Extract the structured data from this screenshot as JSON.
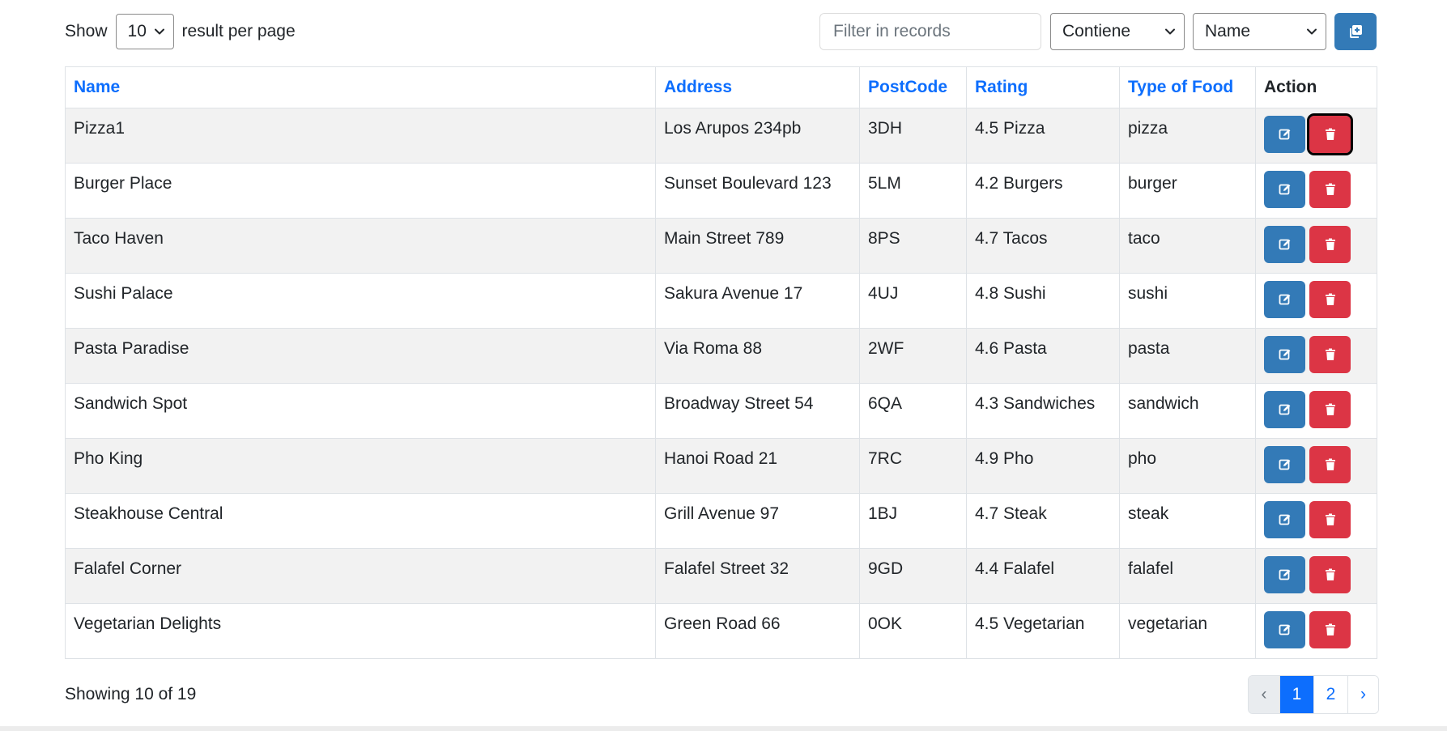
{
  "toolbar": {
    "show_label": "Show",
    "per_page_value": "10",
    "per_page_suffix": "result per page",
    "filter_placeholder": "Filter in records",
    "operator_value": "Contiene",
    "field_value": "Name",
    "add_icon": "add-copy-icon"
  },
  "table": {
    "headers": {
      "name": "Name",
      "address": "Address",
      "postcode": "PostCode",
      "rating": "Rating",
      "type": "Type of Food",
      "action": "Action"
    },
    "rows": [
      {
        "name": "Pizza1",
        "address": "Los Arupos 234pb",
        "postcode": "3DH",
        "rating": "4.5 Pizza",
        "type": "pizza"
      },
      {
        "name": "Burger Place",
        "address": "Sunset Boulevard 123",
        "postcode": "5LM",
        "rating": "4.2 Burgers",
        "type": "burger"
      },
      {
        "name": "Taco Haven",
        "address": "Main Street 789",
        "postcode": "8PS",
        "rating": "4.7 Tacos",
        "type": "taco"
      },
      {
        "name": "Sushi Palace",
        "address": "Sakura Avenue 17",
        "postcode": "4UJ",
        "rating": "4.8 Sushi",
        "type": "sushi"
      },
      {
        "name": "Pasta Paradise",
        "address": "Via Roma 88",
        "postcode": "2WF",
        "rating": "4.6 Pasta",
        "type": "pasta"
      },
      {
        "name": "Sandwich Spot",
        "address": "Broadway Street 54",
        "postcode": "6QA",
        "rating": "4.3 Sandwiches",
        "type": "sandwich"
      },
      {
        "name": "Pho King",
        "address": "Hanoi Road 21",
        "postcode": "7RC",
        "rating": "4.9 Pho",
        "type": "pho"
      },
      {
        "name": "Steakhouse Central",
        "address": "Grill Avenue 97",
        "postcode": "1BJ",
        "rating": "4.7 Steak",
        "type": "steak"
      },
      {
        "name": "Falafel Corner",
        "address": "Falafel Street 32",
        "postcode": "9GD",
        "rating": "4.4 Falafel",
        "type": "falafel"
      },
      {
        "name": "Vegetarian Delights",
        "address": "Green Road 66",
        "postcode": "0OK",
        "rating": "4.5 Vegetarian",
        "type": "vegetarian"
      }
    ],
    "edit_icon": "edit-icon",
    "delete_icon": "trash-icon"
  },
  "footer": {
    "showing_text": "Showing 10 of 19",
    "pagination": {
      "prev": "‹",
      "pages": [
        "1",
        "2"
      ],
      "current": "1",
      "next": "›"
    }
  },
  "colors": {
    "primary_blue": "#337ab7",
    "danger_red": "#dc3545",
    "link_blue": "#0d6efd",
    "stripe": "#f2f2f2"
  }
}
